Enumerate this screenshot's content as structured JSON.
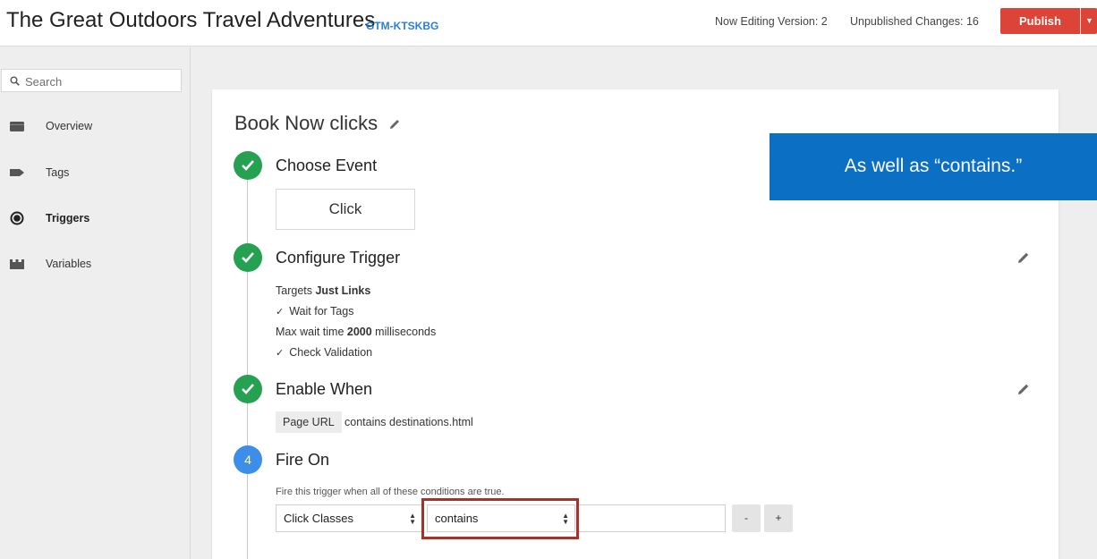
{
  "header": {
    "title": "The Great Outdoors Travel Adventures",
    "container_id": "GTM-KTSKBG",
    "editing_version": "Now Editing Version: 2",
    "unpublished_changes": "Unpublished Changes: 16",
    "publish_label": "Publish"
  },
  "colors": {
    "publish": "#db4437",
    "step_done": "#26a152",
    "step_current": "#3d8ee9",
    "callout": "#0b70c4",
    "highlight": "#a83228",
    "link": "#2a7fd9"
  },
  "sidebar": {
    "search": {
      "placeholder": "Search",
      "value": ""
    },
    "items": [
      {
        "label": "Overview",
        "icon": "folder-icon",
        "active": false
      },
      {
        "label": "Tags",
        "icon": "tag-icon",
        "active": false
      },
      {
        "label": "Triggers",
        "icon": "trigger-icon",
        "active": true
      },
      {
        "label": "Variables",
        "icon": "variables-icon",
        "active": false
      }
    ]
  },
  "trigger": {
    "name": "Book Now clicks",
    "steps": {
      "choose_event": {
        "title": "Choose Event",
        "event": "Click"
      },
      "configure": {
        "title": "Configure Trigger",
        "targets_prefix": "Targets ",
        "targets_value": "Just Links",
        "wait_for_tags": "Wait for Tags",
        "max_wait_prefix": "Max wait time ",
        "max_wait_value": "2000",
        "max_wait_suffix": " milliseconds",
        "check_validation": "Check Validation"
      },
      "enable_when": {
        "title": "Enable When",
        "variable": "Page URL",
        "condition": "contains destinations.html"
      },
      "fire_on": {
        "number": "4",
        "title": "Fire On",
        "description": "Fire this trigger when all of these conditions are true.",
        "variable": "Click Classes",
        "operator": "contains",
        "value": "",
        "remove_label": "-",
        "add_label": "+"
      }
    }
  },
  "callout": {
    "text": "As well as “contains.”"
  }
}
